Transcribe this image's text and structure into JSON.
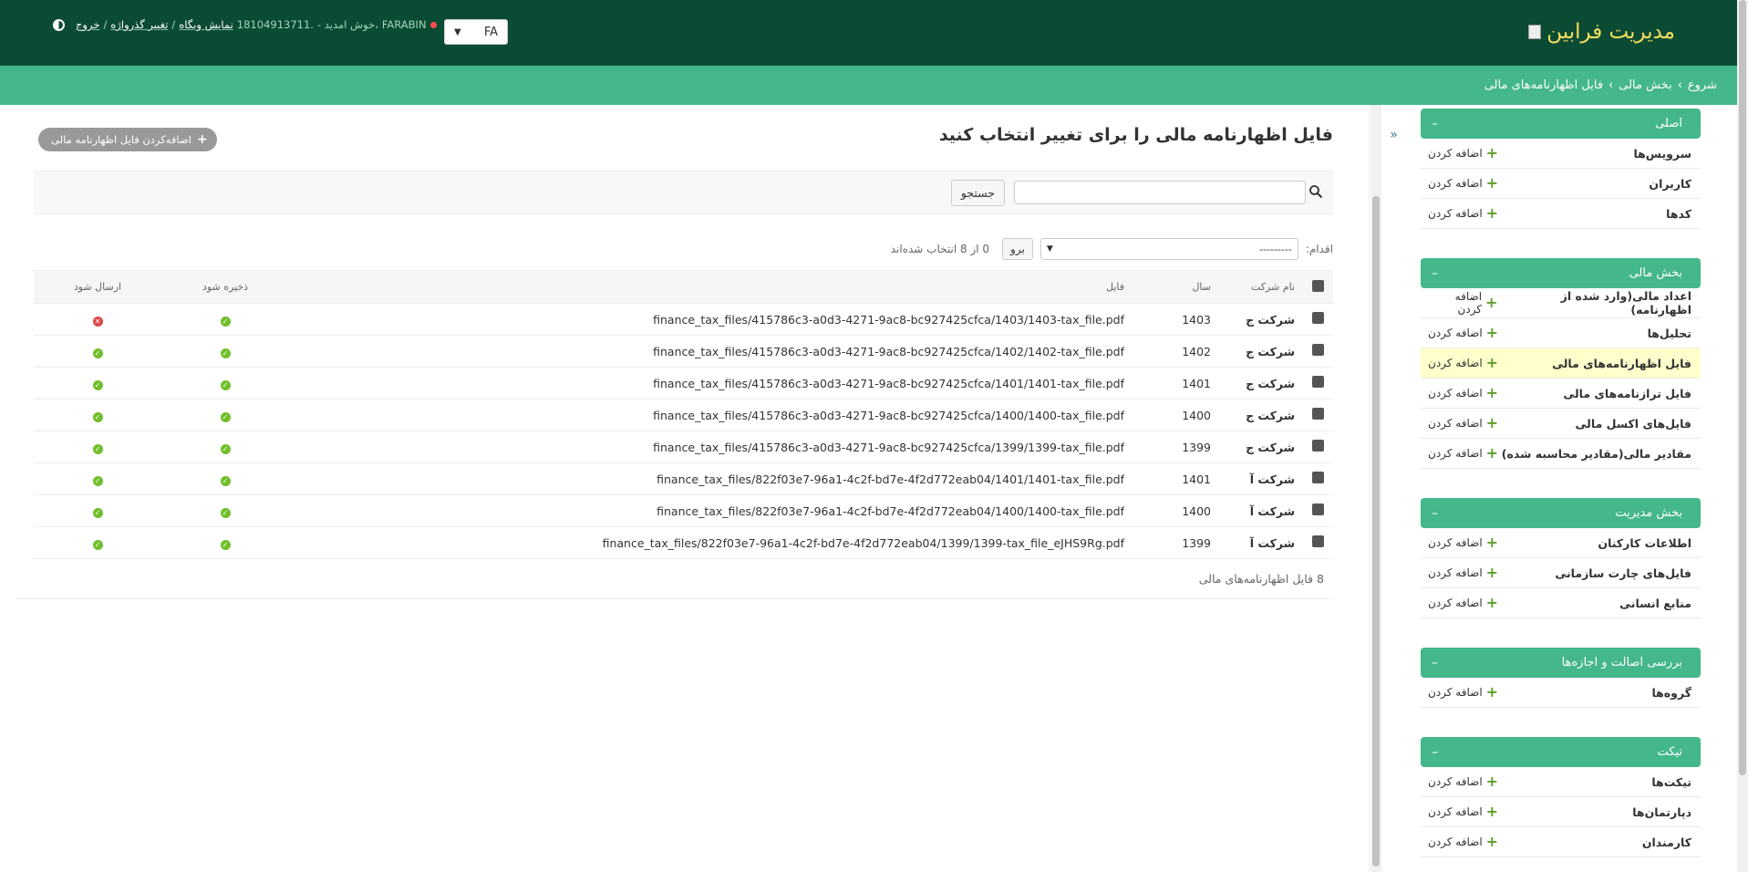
{
  "header": {
    "brand": "مدیریت فرابین",
    "language": "FA",
    "user_tools": {
      "site_name": "FARABIN",
      "welcome": "- خوش امدید،",
      "username": "18104913711.",
      "view_site": "نمایش وبگاه",
      "change_password": "تغییر گذرواژه",
      "logout": "خروج",
      "sep": "/"
    }
  },
  "breadcrumbs": {
    "home": "شروع",
    "section": "بخش مالی",
    "current": "فایل اظهارنامه‌های مالی",
    "sep": "›"
  },
  "sidebar": {
    "toggle": "«",
    "add_label": "اضافه کردن",
    "modules": [
      {
        "caption": "اصلی",
        "rows": [
          {
            "label": "سرویس‌ها"
          },
          {
            "label": "کاربران"
          },
          {
            "label": "کدها"
          }
        ]
      },
      {
        "caption": "بخش مالی",
        "rows": [
          {
            "label": "اعداد مالی(وارد شده از اظهارنامه)"
          },
          {
            "label": "تحلیل‌ها"
          },
          {
            "label": "فایل اظهارنامه‌های مالی"
          },
          {
            "label": "فایل ترازنامه‌های مالی"
          },
          {
            "label": "فایل‌های اکسل مالی"
          },
          {
            "label": "مقادیر مالی(مقادیر محاسبه شده)"
          }
        ]
      },
      {
        "caption": "بخش مدیریت",
        "rows": [
          {
            "label": "اطلاعات کارکنان"
          },
          {
            "label": "فایل‌های چارت سازمانی"
          },
          {
            "label": "منابع انسانی"
          }
        ]
      },
      {
        "caption": "بررسی اصالت و اجازه‌ها",
        "rows": [
          {
            "label": "گروه‌ها"
          }
        ]
      },
      {
        "caption": "تیکت",
        "rows": [
          {
            "label": "تیکت‌ها"
          },
          {
            "label": "دپارتمان‌ها"
          },
          {
            "label": "کارمندان"
          }
        ]
      }
    ]
  },
  "content": {
    "title": "فایل اظهارنامه مالی را برای تغییر انتخاب کنید",
    "add_button": "اضافه‌کردن فایل اظهارنامه مالی",
    "search_button": "جستجو",
    "actions": {
      "label": "اقدام:",
      "selected": "---------",
      "go": "برو",
      "selection_count": "0 از 8 انتخاب شده‌اند"
    },
    "table": {
      "headers": {
        "company": "نام شرکت",
        "year": "سال",
        "file": "فایل",
        "saved": "ذخیره شود",
        "sent": "ارسال شود"
      },
      "rows": [
        {
          "company": "شرکت ج",
          "year": "1403",
          "file": "finance_tax_files/415786c3-a0d3-4271-9ac8-bc927425cfca/1403/1403-tax_file.pdf",
          "saved": "yes",
          "sent": "no"
        },
        {
          "company": "شرکت ج",
          "year": "1402",
          "file": "finance_tax_files/415786c3-a0d3-4271-9ac8-bc927425cfca/1402/1402-tax_file.pdf",
          "saved": "yes",
          "sent": "yes"
        },
        {
          "company": "شرکت ج",
          "year": "1401",
          "file": "finance_tax_files/415786c3-a0d3-4271-9ac8-bc927425cfca/1401/1401-tax_file.pdf",
          "saved": "yes",
          "sent": "yes"
        },
        {
          "company": "شرکت ج",
          "year": "1400",
          "file": "finance_tax_files/415786c3-a0d3-4271-9ac8-bc927425cfca/1400/1400-tax_file.pdf",
          "saved": "yes",
          "sent": "yes"
        },
        {
          "company": "شرکت ج",
          "year": "1399",
          "file": "finance_tax_files/415786c3-a0d3-4271-9ac8-bc927425cfca/1399/1399-tax_file.pdf",
          "saved": "yes",
          "sent": "yes"
        },
        {
          "company": "شرکت آ",
          "year": "1401",
          "file": "finance_tax_files/822f03e7-96a1-4c2f-bd7e-4f2d772eab04/1401/1401-tax_file.pdf",
          "saved": "yes",
          "sent": "yes"
        },
        {
          "company": "شرکت آ",
          "year": "1400",
          "file": "finance_tax_files/822f03e7-96a1-4c2f-bd7e-4f2d772eab04/1400/1400-tax_file.pdf",
          "saved": "yes",
          "sent": "yes"
        },
        {
          "company": "شرکت آ",
          "year": "1399",
          "file": "finance_tax_files/822f03e7-96a1-4c2f-bd7e-4f2d772eab04/1399/1399-tax_file_eJHS9Rg.pdf",
          "saved": "yes",
          "sent": "yes"
        }
      ]
    },
    "paginator": "8 فایل اظهارنامه‌های مالی"
  },
  "colors": {
    "header_bg": "#0c4b33",
    "accent": "#44b78b",
    "brand_text": "#f5dd5d",
    "active_row": "#ffffcc",
    "ok": "#70bf2b",
    "error": "#dd4646"
  }
}
